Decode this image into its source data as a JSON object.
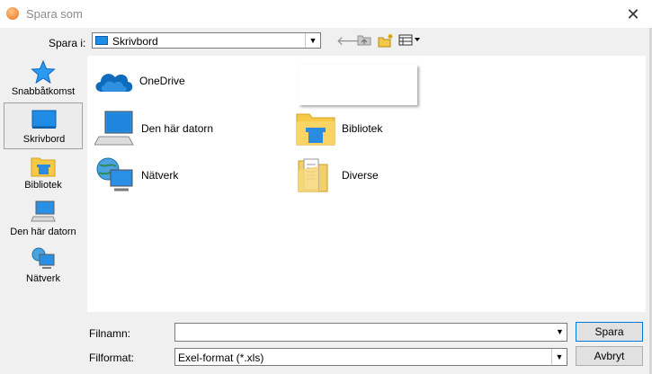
{
  "window": {
    "title": "Spara som",
    "close_glyph": "✕"
  },
  "toolbar": {
    "look_in_label": "Spara i:",
    "look_in_value": "Skrivbord",
    "back_glyph": "🡐",
    "dropdown_arrow": "▼"
  },
  "places": [
    {
      "label": "Snabbåtkomst",
      "icon": "star-icon"
    },
    {
      "label": "Skrivbord",
      "icon": "desktop-icon",
      "active": true
    },
    {
      "label": "Bibliotek",
      "icon": "library-folder-icon"
    },
    {
      "label": "Den här datorn",
      "icon": "computer-icon"
    },
    {
      "label": "Nätverk",
      "icon": "network-icon"
    }
  ],
  "files": [
    {
      "name": "OneDrive",
      "icon": "onedrive-cloud-icon"
    },
    {
      "name": "Den här datorn",
      "icon": "computer-icon"
    },
    {
      "name": "Bibliotek",
      "icon": "library-folder-icon"
    },
    {
      "name": "Nätverk",
      "icon": "network-icon"
    },
    {
      "name": "Diverse",
      "icon": "document-folder-icon"
    }
  ],
  "form": {
    "filename_label": "Filnamn:",
    "filename_value": "",
    "format_label": "Filformat:",
    "format_value": "Exel-format (*.xls)"
  },
  "buttons": {
    "save": "Spara",
    "cancel": "Avbryt"
  },
  "colors": {
    "accent": "#0078d7",
    "onedrive": "#0f6cbd",
    "folder": "#f7c948"
  }
}
